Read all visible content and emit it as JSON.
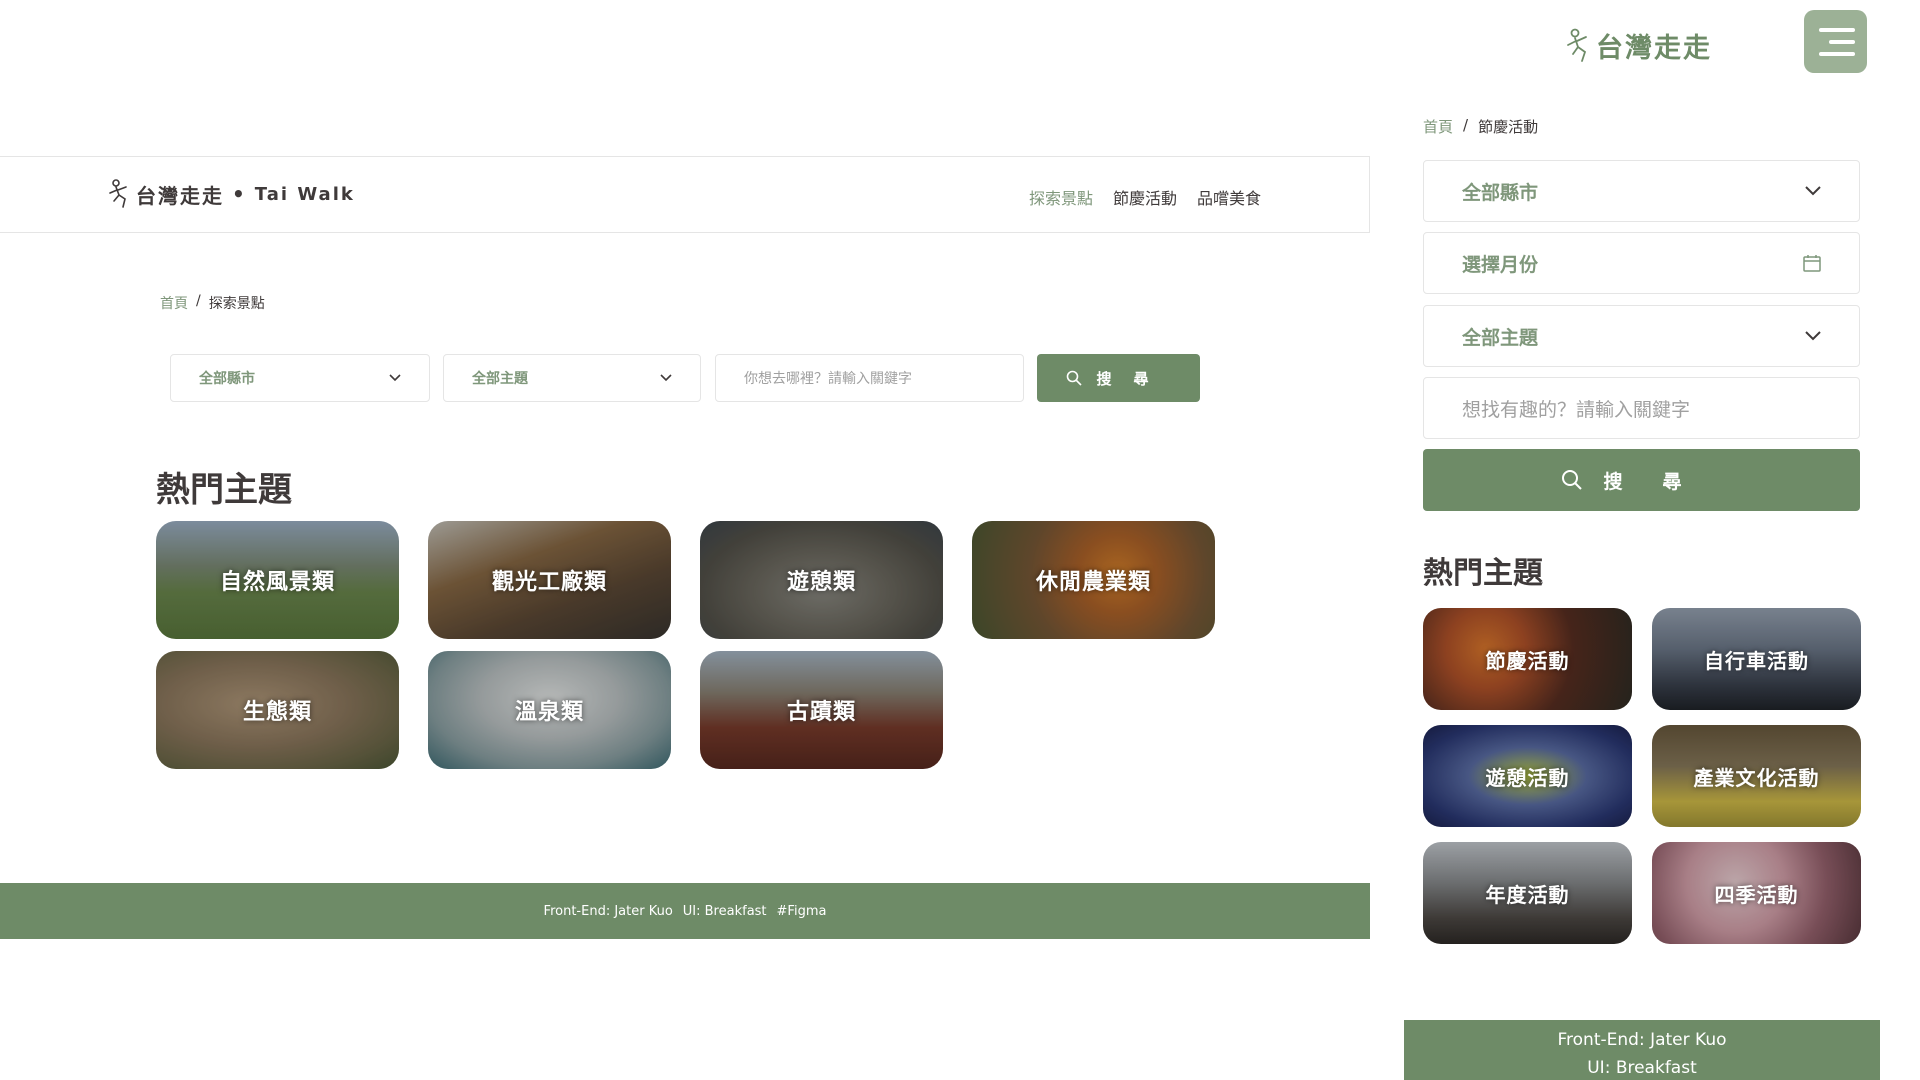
{
  "desktop": {
    "logo": {
      "name": "台灣走走",
      "dot": "•",
      "sub": "Tai Walk"
    },
    "nav": [
      "探索景點",
      "節慶活動",
      "品嚐美食"
    ],
    "breadcrumb": {
      "home": "首頁",
      "sep": "/",
      "current": "探索景點"
    },
    "filters": {
      "city": "全部縣市",
      "theme": "全部主題",
      "keyword_placeholder": "你想去哪裡？請輸入關鍵字",
      "search_label": "搜尋"
    },
    "hot_title": "熱門主題",
    "tiles": [
      "自然風景類",
      "觀光工廠類",
      "遊憩類",
      "休閒農業類",
      "生態類",
      "溫泉類",
      "古蹟類"
    ],
    "footer": {
      "frontend": "Front-End: Jater Kuo",
      "ui": "UI: Breakfast",
      "tag": "#Figma"
    }
  },
  "mobile": {
    "logo": "台灣走走",
    "breadcrumb": {
      "home": "首頁",
      "sep": "/",
      "current": "節慶活動"
    },
    "filters": {
      "city": "全部縣市",
      "month": "選擇月份",
      "theme": "全部主題",
      "keyword_placeholder": "想找有趣的？請輸入關鍵字",
      "search_label": "搜尋"
    },
    "hot_title": "熱門主題",
    "tiles": [
      "節慶活動",
      "自行車活動",
      "遊憩活動",
      "產業文化活動",
      "年度活動",
      "四季活動"
    ],
    "footer": {
      "frontend": "Front-End: Jater Kuo",
      "ui": "UI: Breakfast"
    }
  },
  "colors": {
    "brand_green": "#6e8b67",
    "light_green": "#9cb196",
    "text": "#3f3a3a",
    "muted": "#a0a0a0",
    "border": "#e5e5e5"
  }
}
